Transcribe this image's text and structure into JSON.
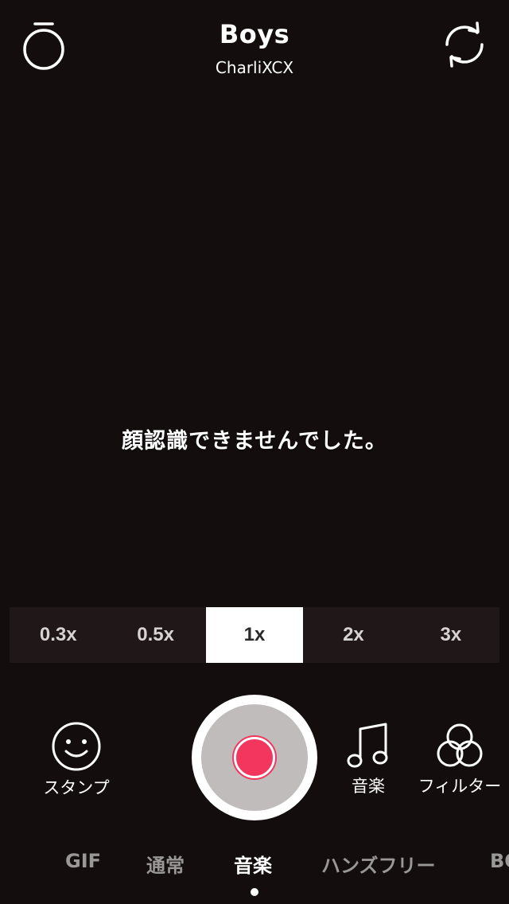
{
  "header": {
    "song_title": "Boys",
    "artist": "CharliXCX",
    "timer_icon": "timer-icon",
    "flip_camera_icon": "flip-camera-icon"
  },
  "camera": {
    "face_message": "顔認識できませんでした。"
  },
  "speed": {
    "options": [
      "0.3x",
      "0.5x",
      "1x",
      "2x",
      "3x"
    ],
    "selected": "1x"
  },
  "controls": {
    "stamp_label": "スタンプ",
    "music_label": "音楽",
    "filter_label": "フィルター",
    "record_color": "#f2365e"
  },
  "modes": {
    "items": [
      "GIF",
      "通常",
      "音楽",
      "ハンズフリー",
      "BO"
    ],
    "selected": "音楽"
  }
}
